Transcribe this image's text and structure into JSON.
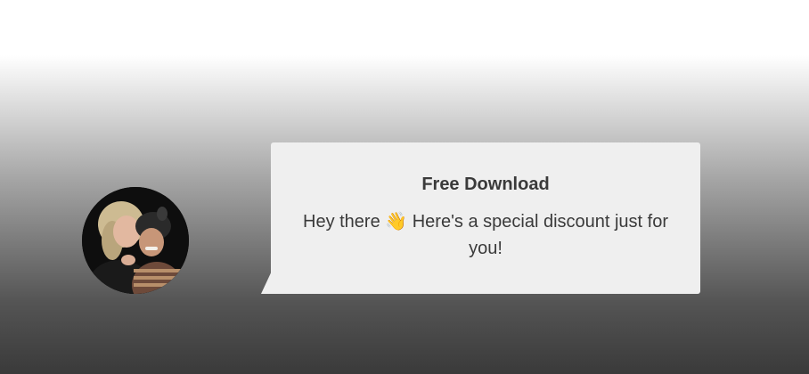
{
  "popup": {
    "title": "Free Download",
    "message": "Hey there 👋 Here's a special discount just for you!"
  },
  "avatar": {
    "alt": "Profile photo of two smiling women"
  },
  "colors": {
    "bubble_background": "#efefef",
    "text": "#3a3a3a",
    "gradient_top": "#ffffff",
    "gradient_bottom": "#3a3a3a"
  }
}
